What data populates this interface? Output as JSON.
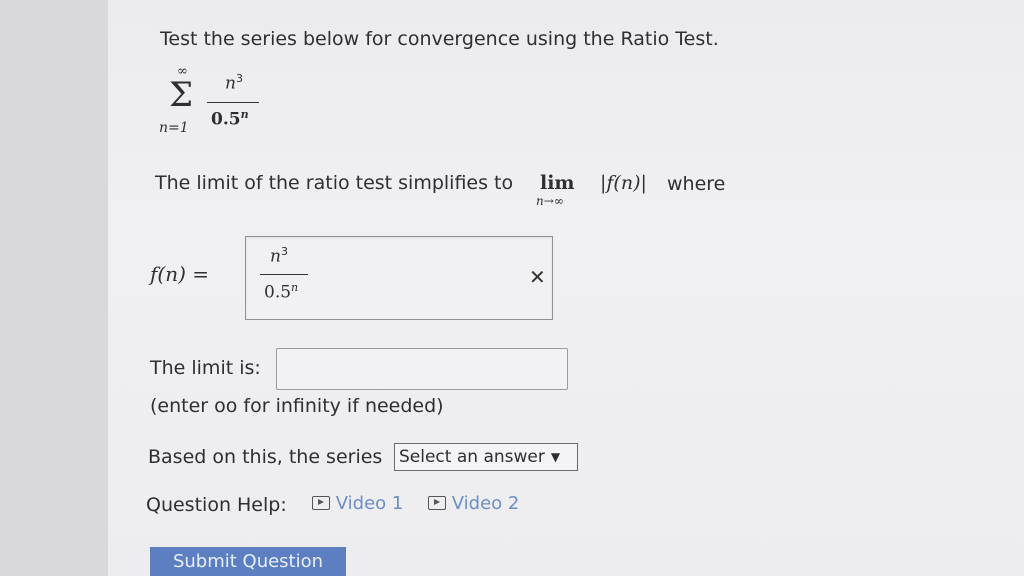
{
  "question": {
    "prompt": "Test the series below for convergence using the Ratio Test.",
    "series": {
      "sum_symbol": "Σ",
      "upper": "∞",
      "lower": "n=1",
      "numerator_base": "n",
      "numerator_exp": "3",
      "denominator_base": "0.5",
      "denominator_exp": "n"
    },
    "limit_sentence": "The limit of the ratio test simplifies to",
    "lim_word": "lim",
    "lim_sub": "n→∞",
    "abs_expr": "|f(n)|",
    "where_word": "where"
  },
  "fn_answer": {
    "label": "f(n) =",
    "numerator_base": "n",
    "numerator_exp": "3",
    "denominator_base": "0.5",
    "denominator_exp": "n",
    "status_icon": "x-icon"
  },
  "limit": {
    "label": "The limit is:",
    "value": "",
    "hint": "(enter oo for infinity if needed)"
  },
  "series_result": {
    "label": "Based on this, the series",
    "select_value": "Select an answer"
  },
  "help": {
    "label": "Question Help:",
    "videos": [
      "Video 1",
      "Video 2"
    ]
  },
  "submit": {
    "label": "Submit Question"
  },
  "colors": {
    "link": "#6d8ec7",
    "submit_bg": "#5b7fc1"
  }
}
